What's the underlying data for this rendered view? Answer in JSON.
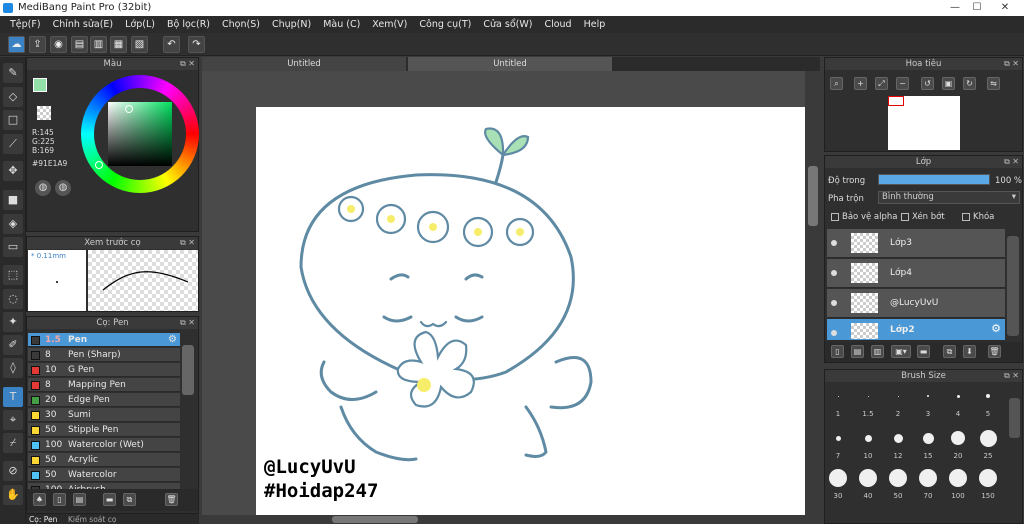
{
  "window": {
    "title": "MediBang Paint Pro (32bit)",
    "min": "—",
    "max": "☐",
    "close": "✕"
  },
  "menu": [
    "Tệp(F)",
    "Chỉnh sửa(E)",
    "Lớp(L)",
    "Bộ lọc(R)",
    "Chọn(S)",
    "Chụp(N)",
    "Màu (C)",
    "Xem(V)",
    "Công cụ(T)",
    "Cửa sổ(W)",
    "Cloud",
    "Help"
  ],
  "tabs": [
    "Untitled",
    "Untitled"
  ],
  "color_panel": {
    "title": "Màu",
    "r": "R:145",
    "g": "G:225",
    "b": "B:169",
    "hex": "#91E1A9",
    "fg_color": "#91E1A9"
  },
  "preview_panel": {
    "title": "Xem trước cọ",
    "size": "0.11mm"
  },
  "brush_panel": {
    "title": "Cọ: Pen",
    "brushes": [
      {
        "size": "1.5",
        "name": "Pen",
        "color": "#3a3a3a"
      },
      {
        "size": "8",
        "name": "Pen (Sharp)",
        "color": "#3a3a3a"
      },
      {
        "size": "10",
        "name": "G Pen",
        "color": "#e53935"
      },
      {
        "size": "8",
        "name": "Mapping Pen",
        "color": "#e53935"
      },
      {
        "size": "20",
        "name": "Edge Pen",
        "color": "#43a047"
      },
      {
        "size": "30",
        "name": "Sumi",
        "color": "#fdd835"
      },
      {
        "size": "50",
        "name": "Stipple Pen",
        "color": "#fdd835"
      },
      {
        "size": "100",
        "name": "Watercolor (Wet)",
        "color": "#4fc3f7"
      },
      {
        "size": "50",
        "name": "Acrylic",
        "color": "#fdd835"
      },
      {
        "size": "50",
        "name": "Watercolor",
        "color": "#4fc3f7"
      },
      {
        "size": "100",
        "name": "Airbrush",
        "color": "#3a3a3a"
      }
    ]
  },
  "bottom_tabs": [
    "Cọ: Pen",
    "Kiểm soát cọ"
  ],
  "navigator": {
    "title": "Hoa tiêu"
  },
  "layer_panel": {
    "title": "Lớp",
    "opacity_label": "Độ trong",
    "opacity_value": "100 %",
    "opacity_pct": 100,
    "blend_label": "Pha trộn",
    "blend_value": "Bình thường",
    "check_alpha": "Bảo vệ alpha",
    "check_clip": "Xén bớt",
    "check_lock": "Khóa",
    "layers": [
      "Lớp3",
      "Lớp4",
      "@LucyUvU",
      "Lớp2"
    ]
  },
  "brush_size_panel": {
    "title": "Brush Size",
    "row1": [
      "1",
      "1.5",
      "2",
      "3",
      "4",
      "5"
    ],
    "row2": [
      "7",
      "10",
      "12",
      "15",
      "20",
      "25"
    ],
    "row3": [
      "30",
      "40",
      "50",
      "70",
      "100",
      "150"
    ]
  },
  "canvas": {
    "watermark1": "@LucyUvU",
    "watermark2": "#Hoidap247"
  }
}
